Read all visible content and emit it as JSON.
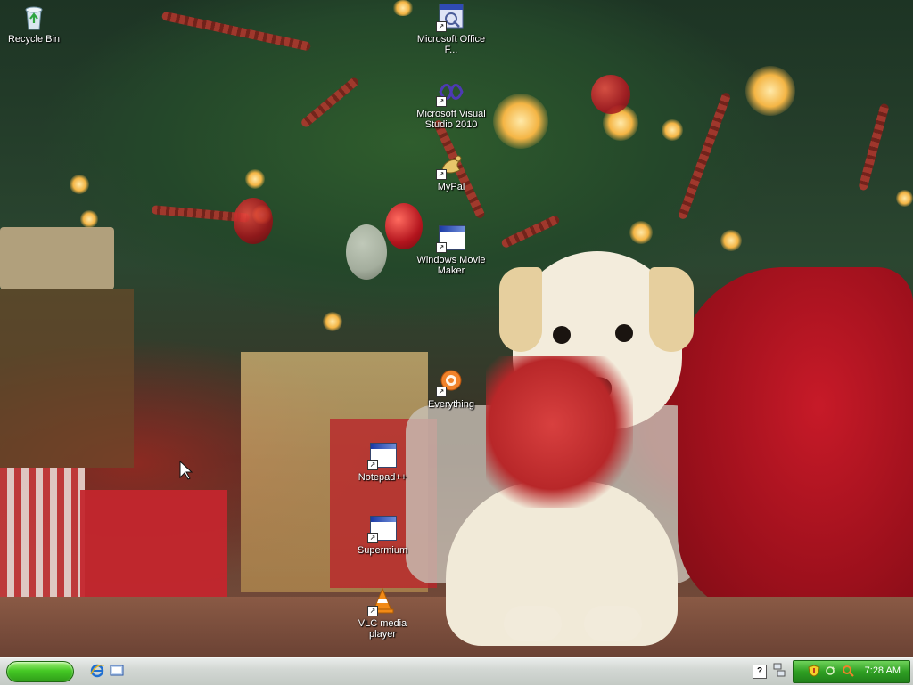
{
  "desktop": {
    "icons": [
      {
        "label": "Recycle Bin"
      },
      {
        "label": "Microsoft Office F..."
      },
      {
        "label": "Microsoft Visual Studio 2010"
      },
      {
        "label": "MyPal"
      },
      {
        "label": "Windows Movie Maker"
      },
      {
        "label": "Everything"
      },
      {
        "label": "Notepad++"
      },
      {
        "label": "Supermium"
      },
      {
        "label": "VLC media player"
      }
    ]
  },
  "taskbar": {
    "quicklaunch": [
      "internet-explorer-icon",
      "show-desktop-icon"
    ],
    "notification_icons": [
      "help-icon",
      "network-icon",
      "security-shield-icon",
      "sync-icon",
      "everything-search-icon"
    ],
    "clock": "7:28 AM"
  },
  "colors": {
    "start_green": "#45c925",
    "tray_green": "#2f9f23",
    "taskbar_gray": "#d3d8d4"
  }
}
